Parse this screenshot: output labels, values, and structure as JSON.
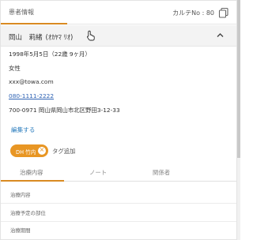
{
  "header": {
    "tab_label": "患者情報",
    "karte_label": "カルテNo : 80"
  },
  "patient": {
    "name": "岡山　莉緒",
    "kana": "(ｵｶﾔﾏ ﾘｵ)",
    "birth": "1998年5月5日（22歳 9ヶ月）",
    "gender": "女性",
    "email": "xxx@towa.com",
    "phone": "080-1111-2222",
    "address": "700-0971 岡山県岡山市北区野田3-12-33"
  },
  "actions": {
    "edit_label": "編集する"
  },
  "tags": {
    "chip_label": "DH 竹内",
    "add_label": "タグ追加"
  },
  "tabs": [
    {
      "label": "治療内容"
    },
    {
      "label": "ノート"
    },
    {
      "label": "関係者"
    }
  ],
  "treatment_rows": [
    {
      "label": "治療内容"
    },
    {
      "label": "治療予定の部位"
    },
    {
      "label": "治療期間"
    }
  ],
  "icons": {
    "copy": "copy-icon",
    "collapse": "chevron-up-icon",
    "cursor": "hand-cursor-icon",
    "chip_remove": "close-icon"
  },
  "colors": {
    "accent": "#e89624",
    "link": "#2f63b4",
    "edit_link": "#2f7fbf"
  }
}
